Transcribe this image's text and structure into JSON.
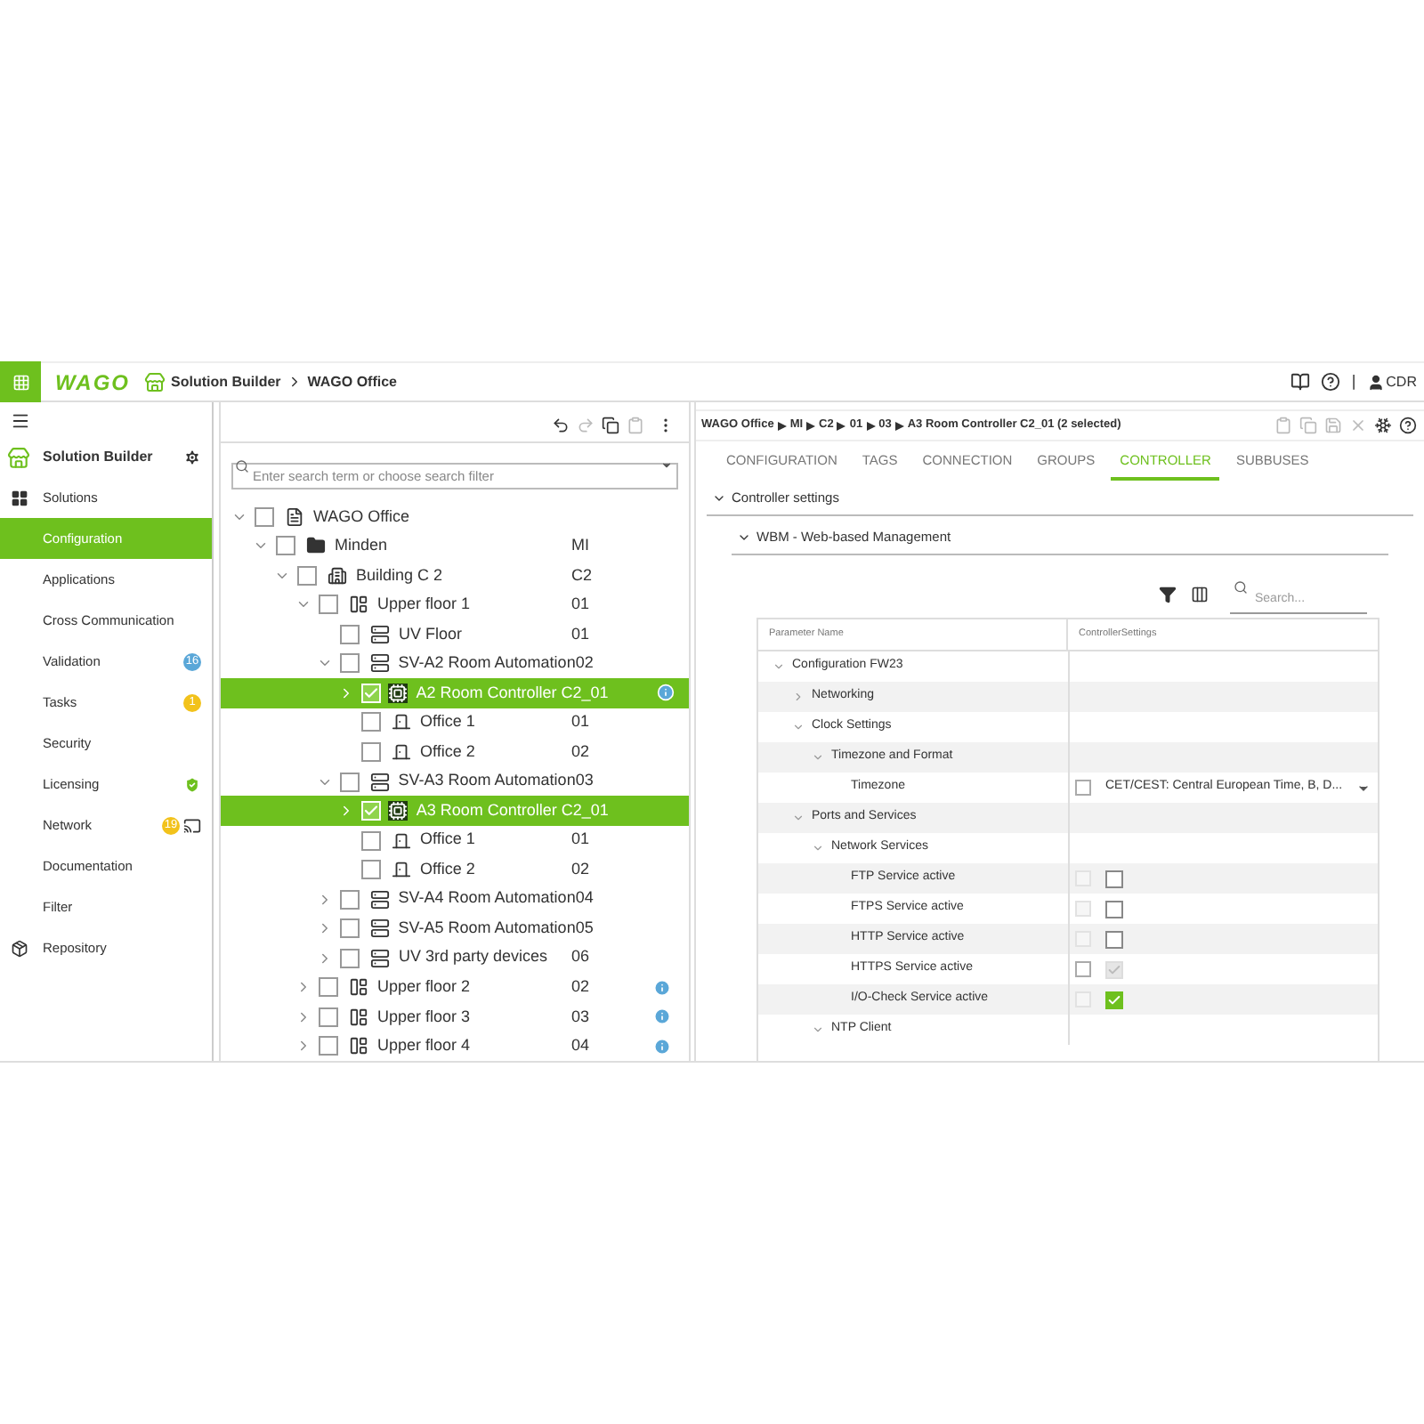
{
  "header": {
    "logo": "WAGO",
    "breadcrumb": [
      "Solution Builder",
      "WAGO Office"
    ],
    "separator": "|",
    "user": "CDR"
  },
  "sidebar": {
    "title": "Solution Builder",
    "items": [
      {
        "label": "Solutions",
        "selected": false
      },
      {
        "label": "Configuration",
        "selected": true
      },
      {
        "label": "Applications",
        "selected": false
      },
      {
        "label": "Cross Communication",
        "selected": false
      },
      {
        "label": "Validation",
        "selected": false,
        "badge": {
          "text": "16",
          "color": "#5aa7d8"
        }
      },
      {
        "label": "Tasks",
        "selected": false,
        "badge": {
          "text": "1",
          "color": "#f2c21b"
        }
      },
      {
        "label": "Security",
        "selected": false
      },
      {
        "label": "Licensing",
        "selected": false
      },
      {
        "label": "Network",
        "selected": false,
        "badge": {
          "text": "19",
          "color": "#f2c21b"
        }
      },
      {
        "label": "Documentation",
        "selected": false
      },
      {
        "label": "Filter",
        "selected": false
      },
      {
        "label": "Repository",
        "selected": false
      }
    ]
  },
  "tree": {
    "search": {
      "placeholder": "Enter search term or choose search filter"
    },
    "nodes": [
      {
        "label": "WAGO Office",
        "kind": "project",
        "checked": false,
        "selected": false,
        "expanded": true,
        "children": [
          {
            "label": "Minden",
            "kind": "folder",
            "code": "MI",
            "checked": false,
            "selected": false,
            "expanded": true,
            "children": [
              {
                "label": "Building C 2",
                "kind": "building",
                "code": "C2",
                "checked": false,
                "selected": false,
                "expanded": true,
                "children": [
                  {
                    "label": "Upper floor 1",
                    "kind": "floor",
                    "code": "01",
                    "checked": false,
                    "selected": false,
                    "expanded": true,
                    "children": [
                      {
                        "label": "UV Floor",
                        "kind": "cabinet",
                        "code": "01",
                        "checked": false,
                        "selected": false
                      },
                      {
                        "label": "SV-A2 Room Automation",
                        "kind": "cabinet",
                        "code": "02",
                        "checked": false,
                        "selected": false,
                        "expanded": true,
                        "children": [
                          {
                            "label": "A2 Room Controller C2_01",
                            "kind": "controller",
                            "checked": true,
                            "selected": true,
                            "expanded": false,
                            "info": true
                          },
                          {
                            "label": "Office 1",
                            "kind": "room",
                            "code": "01",
                            "checked": false,
                            "selected": false
                          },
                          {
                            "label": "Office 2",
                            "kind": "room",
                            "code": "02",
                            "checked": false,
                            "selected": false
                          }
                        ]
                      },
                      {
                        "label": "SV-A3 Room Automation",
                        "kind": "cabinet",
                        "code": "03",
                        "checked": false,
                        "selected": false,
                        "expanded": true,
                        "children": [
                          {
                            "label": "A3 Room Controller C2_01",
                            "kind": "controller",
                            "checked": true,
                            "selected": true,
                            "expanded": false
                          },
                          {
                            "label": "Office 1",
                            "kind": "room",
                            "code": "01",
                            "checked": false,
                            "selected": false
                          },
                          {
                            "label": "Office 2",
                            "kind": "room",
                            "code": "02",
                            "checked": false,
                            "selected": false
                          }
                        ]
                      },
                      {
                        "label": "SV-A4 Room Automation",
                        "kind": "cabinet",
                        "code": "04",
                        "checked": false,
                        "selected": false,
                        "expanded": false
                      },
                      {
                        "label": "SV-A5 Room Automation",
                        "kind": "cabinet",
                        "code": "05",
                        "checked": false,
                        "selected": false,
                        "expanded": false
                      },
                      {
                        "label": "UV 3rd party devices",
                        "kind": "cabinet",
                        "code": "06",
                        "checked": false,
                        "selected": false,
                        "expanded": false
                      }
                    ]
                  },
                  {
                    "label": "Upper floor 2",
                    "kind": "floor",
                    "code": "02",
                    "checked": false,
                    "selected": false,
                    "expanded": false,
                    "info": true
                  },
                  {
                    "label": "Upper floor 3",
                    "kind": "floor",
                    "code": "03",
                    "checked": false,
                    "selected": false,
                    "expanded": false,
                    "info": true
                  },
                  {
                    "label": "Upper floor 4",
                    "kind": "floor",
                    "code": "04",
                    "checked": false,
                    "selected": false,
                    "expanded": false,
                    "info": true
                  }
                ]
              }
            ]
          }
        ]
      }
    ]
  },
  "detail": {
    "path": [
      "WAGO Office",
      "MI",
      "C2",
      "01",
      "03",
      "A3 Room Controller C2_01 (2 selected)"
    ],
    "tabs": [
      {
        "label": "CONFIGURATION",
        "selected": false
      },
      {
        "label": "TAGS",
        "selected": false
      },
      {
        "label": "CONNECTION",
        "selected": false
      },
      {
        "label": "GROUPS",
        "selected": false
      },
      {
        "label": "CONTROLLER",
        "selected": true
      },
      {
        "label": "SUBBUSES",
        "selected": false
      }
    ],
    "sections": [
      {
        "label": "Controller settings",
        "expanded": true
      },
      {
        "label": "WBM - Web-based Management",
        "expanded": true
      }
    ],
    "search": {
      "placeholder": "Search..."
    },
    "table": {
      "columns": [
        "Parameter Name",
        "ControllerSettings"
      ],
      "rows": [
        {
          "name": "Configuration FW23",
          "expanded": true,
          "children": [
            {
              "name": "Networking",
              "expanded": false
            },
            {
              "name": "Clock Settings",
              "expanded": true,
              "children": [
                {
                  "name": "Timezone and Format",
                  "expanded": true,
                  "children": [
                    {
                      "name": "Timezone",
                      "override_disabled": false,
                      "value": {
                        "kind": "select",
                        "text": "CET/CEST: Central European Time, B, D..."
                      }
                    }
                  ]
                }
              ]
            },
            {
              "name": "Ports and Services",
              "expanded": true,
              "children": [
                {
                  "name": "Network Services",
                  "expanded": true,
                  "children": [
                    {
                      "name": "FTP Service active",
                      "override_disabled": true,
                      "value": {
                        "kind": "checkbox",
                        "checked": false,
                        "disabled": false
                      }
                    },
                    {
                      "name": "FTPS Service active",
                      "override_disabled": true,
                      "value": {
                        "kind": "checkbox",
                        "checked": false,
                        "disabled": false
                      }
                    },
                    {
                      "name": "HTTP Service active",
                      "override_disabled": true,
                      "value": {
                        "kind": "checkbox",
                        "checked": false,
                        "disabled": false
                      }
                    },
                    {
                      "name": "HTTPS Service active",
                      "override_disabled": false,
                      "value": {
                        "kind": "checkbox",
                        "checked": true,
                        "disabled": true
                      }
                    },
                    {
                      "name": "I/O-Check Service active",
                      "override_disabled": true,
                      "value": {
                        "kind": "checkbox",
                        "checked": true,
                        "disabled": false
                      }
                    }
                  ]
                },
                {
                  "name": "NTP Client",
                  "expanded": true
                }
              ]
            }
          ]
        }
      ]
    }
  }
}
